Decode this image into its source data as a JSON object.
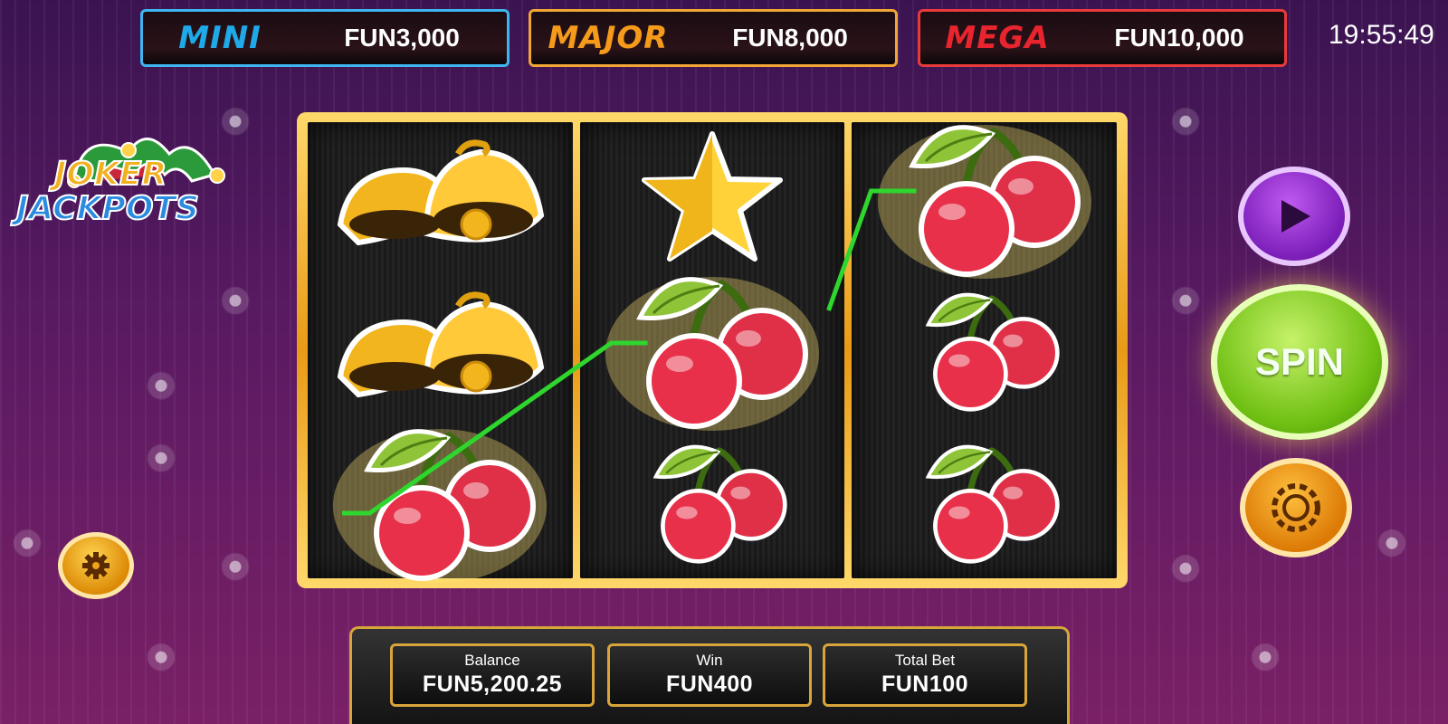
{
  "jackpots": [
    {
      "name": "MINI",
      "value": "FUN3,000",
      "color": "#1fa9e8",
      "border": "#3fb5f0"
    },
    {
      "name": "MAJOR",
      "value": "FUN8,000",
      "color": "#f59a1a",
      "border": "#f0a535"
    },
    {
      "name": "MEGA",
      "value": "FUN10,000",
      "color": "#e8242e",
      "border": "#e83a3a"
    }
  ],
  "clock": "19:55:49",
  "logo": {
    "line1": "JOKER",
    "line2": "JACKPOTS"
  },
  "reels": [
    [
      "bell",
      "bell",
      "cherry-large"
    ],
    [
      "star",
      "cherry-large",
      "cherry"
    ],
    [
      "cherry-large",
      "cherry",
      "cherry"
    ]
  ],
  "win_line": [
    [
      0,
      2
    ],
    [
      1,
      1
    ],
    [
      2,
      0
    ]
  ],
  "buttons": {
    "spin_label": "SPIN",
    "play_icon": "play-icon",
    "chip_icon": "chip-icon",
    "settings_icon": "gear-icon"
  },
  "info": {
    "balance_label": "Balance",
    "balance_value": "FUN5,200.25",
    "win_label": "Win",
    "win_value": "FUN400",
    "bet_label": "Total Bet",
    "bet_value": "FUN100"
  },
  "colors": {
    "payline": "#2ed62e",
    "frame_gold": "#e8a21a"
  }
}
